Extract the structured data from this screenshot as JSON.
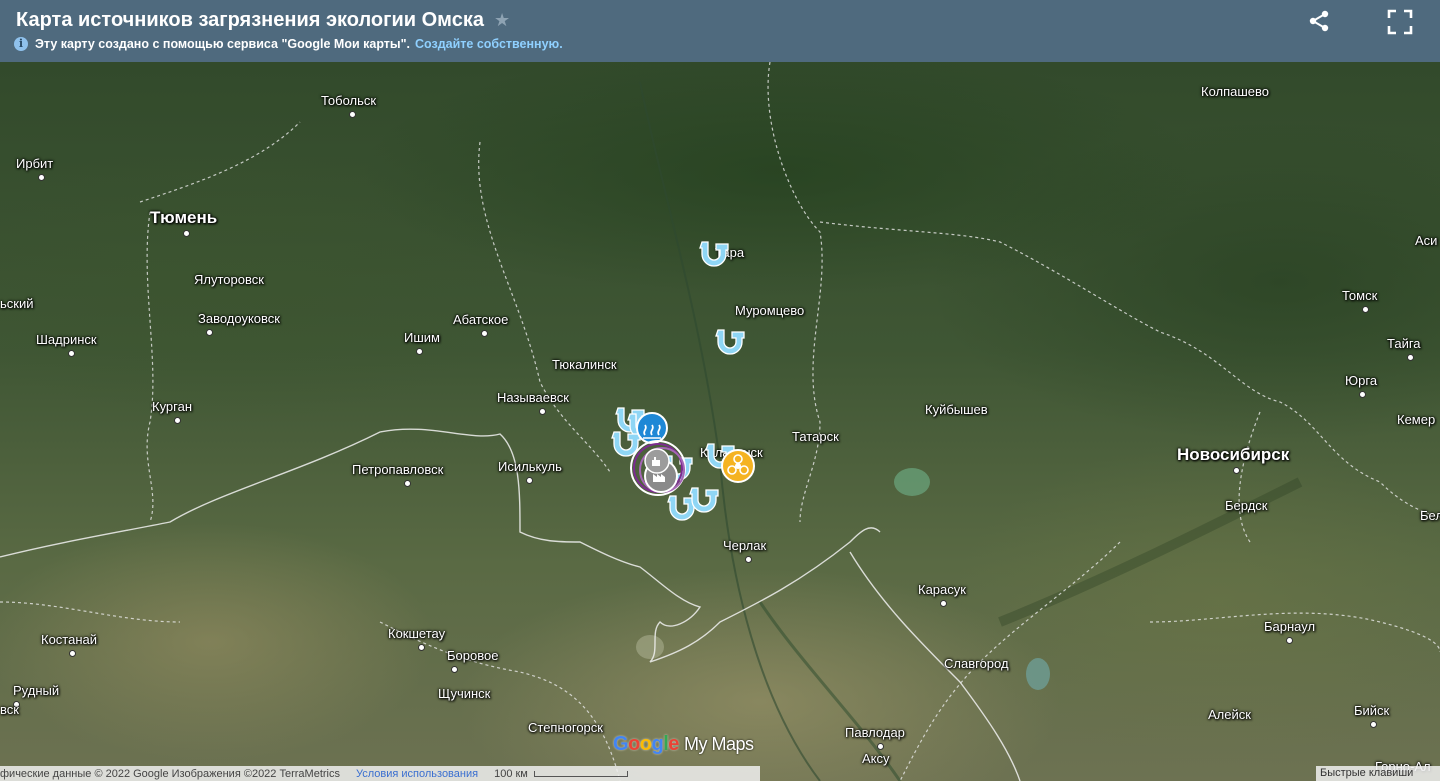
{
  "header": {
    "title": "Карта источников загрязнения экологии Омска",
    "info_text": "Эту карту создано с помощью сервиса \"Google Мои карты\".",
    "info_link": "Создайте собственную.",
    "share_icon": "share-icon",
    "fullscreen_icon": "fullscreen-icon"
  },
  "cities": [
    {
      "id": "tobolsk",
      "name": "Тобольск"
    },
    {
      "id": "kolpashevo",
      "name": "Колпашево"
    },
    {
      "id": "irbit",
      "name": "Ирбит"
    },
    {
      "id": "tyumen",
      "name": "Тюмень"
    },
    {
      "id": "asino",
      "name": "Аси"
    },
    {
      "id": "tara",
      "name": "Тара"
    },
    {
      "id": "yalutorovsk",
      "name": "Ялуторовск"
    },
    {
      "id": "kamyshlov",
      "name": "ьский"
    },
    {
      "id": "tomsk",
      "name": "Томск"
    },
    {
      "id": "muromtsevo",
      "name": "Муромцево"
    },
    {
      "id": "zavodoukovsk",
      "name": "Заводоуковск"
    },
    {
      "id": "abatskoe",
      "name": "Абатское"
    },
    {
      "id": "shadrinsk",
      "name": "Шадринск"
    },
    {
      "id": "ishim",
      "name": "Ишим"
    },
    {
      "id": "taiga",
      "name": "Тайга"
    },
    {
      "id": "tyukalinsk",
      "name": "Тюкалинск"
    },
    {
      "id": "yurga",
      "name": "Юрга"
    },
    {
      "id": "nazyvaevsk",
      "name": "Называевск"
    },
    {
      "id": "kurgan",
      "name": "Курган"
    },
    {
      "id": "kuibyshev",
      "name": "Куйбышев"
    },
    {
      "id": "kemerovo",
      "name": "Кемер"
    },
    {
      "id": "tatarsk",
      "name": "Татарск"
    },
    {
      "id": "kalachinsk",
      "name": "Калачинск"
    },
    {
      "id": "novosibirsk",
      "name": "Новосибирск"
    },
    {
      "id": "petropavlovsk",
      "name": "Петропавловск"
    },
    {
      "id": "isilkul",
      "name": "Исилькуль"
    },
    {
      "id": "berdsk",
      "name": "Бердск"
    },
    {
      "id": "belovo",
      "name": "Бел"
    },
    {
      "id": "cherlak",
      "name": "Черлак"
    },
    {
      "id": "karasuk",
      "name": "Карасук"
    },
    {
      "id": "barnaul",
      "name": "Барнаул"
    },
    {
      "id": "kokshetau",
      "name": "Кокшетау"
    },
    {
      "id": "kostanay",
      "name": "Костанай"
    },
    {
      "id": "borovoe",
      "name": "Боровое"
    },
    {
      "id": "slavgorod",
      "name": "Славгород"
    },
    {
      "id": "rudny",
      "name": "Рудный"
    },
    {
      "id": "shchuchinsk",
      "name": "Щучинск"
    },
    {
      "id": "aleysk",
      "name": "Алейск"
    },
    {
      "id": "biysk",
      "name": "Бийск"
    },
    {
      "id": "kosk",
      "name": "вск"
    },
    {
      "id": "stepnogorsk",
      "name": "Степногорск"
    },
    {
      "id": "pavlodar",
      "name": "Павлодар"
    },
    {
      "id": "aksu",
      "name": "Аксу"
    },
    {
      "id": "gorno",
      "name": "Горно-Ал"
    }
  ],
  "markers": {
    "pipe_color": "#8fd6f5",
    "steam_color": "#1e88d6",
    "biohazard_color": "#f5b321",
    "factory_ring_color": "#7b2c8f",
    "factory_fill": "#8a8a8a"
  },
  "footer": {
    "attribution": "фические данные © 2022 Google Изображения ©2022 TerraMetrics",
    "tos": "Условия использования",
    "scale": "100 км",
    "shortcuts": "Быстрые клавиши"
  },
  "logo": {
    "google": "Google",
    "mymaps": "My Maps"
  }
}
